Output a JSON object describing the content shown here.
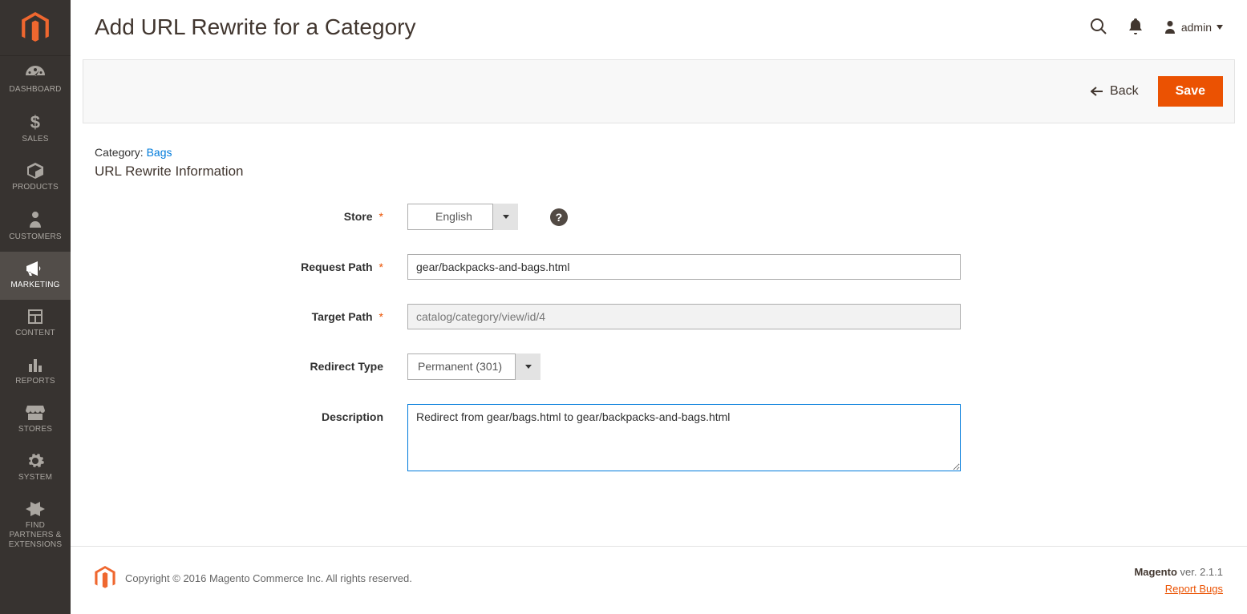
{
  "sidebar": {
    "items": [
      {
        "id": "dashboard",
        "label": "DASHBOARD"
      },
      {
        "id": "sales",
        "label": "SALES"
      },
      {
        "id": "products",
        "label": "PRODUCTS"
      },
      {
        "id": "customers",
        "label": "CUSTOMERS"
      },
      {
        "id": "marketing",
        "label": "MARKETING"
      },
      {
        "id": "content",
        "label": "CONTENT"
      },
      {
        "id": "reports",
        "label": "REPORTS"
      },
      {
        "id": "stores",
        "label": "STORES"
      },
      {
        "id": "system",
        "label": "SYSTEM"
      },
      {
        "id": "partners",
        "label": "FIND PARTNERS & EXTENSIONS"
      }
    ],
    "active": "marketing"
  },
  "header": {
    "title": "Add URL Rewrite for a Category",
    "user": "admin"
  },
  "actions": {
    "back": "Back",
    "save": "Save"
  },
  "category": {
    "prefix": "Category: ",
    "link_text": "Bags"
  },
  "section_title": "URL Rewrite Information",
  "form": {
    "store": {
      "label": "Store",
      "value": "English"
    },
    "request_path": {
      "label": "Request Path",
      "value": "gear/backpacks-and-bags.html"
    },
    "target_path": {
      "label": "Target Path",
      "value": "catalog/category/view/id/4"
    },
    "redirect_type": {
      "label": "Redirect Type",
      "value": "Permanent (301)"
    },
    "description": {
      "label": "Description",
      "value": "Redirect from gear/bags.html to gear/backpacks-and-bags.html"
    }
  },
  "footer": {
    "copyright": "Copyright © 2016 Magento Commerce Inc. All rights reserved.",
    "product": "Magento",
    "version_label": " ver. 2.1.1",
    "report": "Report Bugs"
  },
  "colors": {
    "accent": "#eb5202",
    "sidebar": "#373330",
    "link": "#007bdb"
  }
}
